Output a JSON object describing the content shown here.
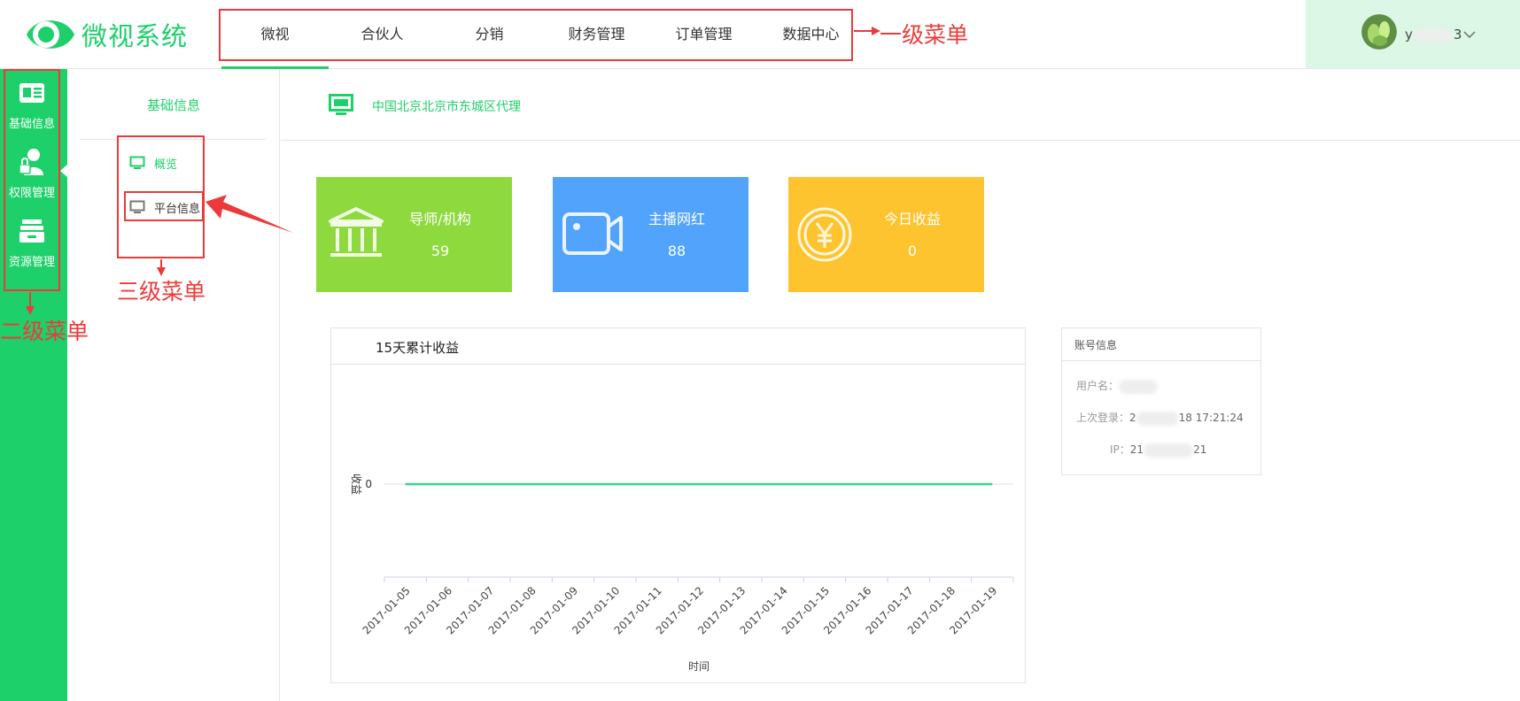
{
  "app": {
    "title": "微视系统"
  },
  "topnav": {
    "items": [
      {
        "label": "微视"
      },
      {
        "label": "合伙人"
      },
      {
        "label": "分销"
      },
      {
        "label": "财务管理"
      },
      {
        "label": "订单管理"
      },
      {
        "label": "数据中心"
      }
    ],
    "active_index": 0
  },
  "user": {
    "name": "y",
    "name_tail": "3"
  },
  "sidebar": {
    "items": [
      {
        "label": "基础信息",
        "icon": "id-card-icon",
        "active": true
      },
      {
        "label": "权限管理",
        "icon": "user-lock-icon"
      },
      {
        "label": "资源管理",
        "icon": "drawer-icon"
      }
    ]
  },
  "submenu": {
    "title": "基础信息",
    "items": [
      {
        "label": "概览",
        "icon": "monitor-icon",
        "active": true
      },
      {
        "label": "平台信息",
        "icon": "monitor-icon"
      }
    ]
  },
  "breadcrumb": {
    "text": "中国北京北京市东城区代理",
    "icon": "monitor-icon"
  },
  "cards": [
    {
      "title": "导师/机构",
      "value": "59",
      "color": "#8ed93e",
      "icon": "bank-icon"
    },
    {
      "title": "主播网红",
      "value": "88",
      "color": "#52a3fb",
      "icon": "video-camera-icon"
    },
    {
      "title": "今日收益",
      "value": "0",
      "color": "#fdc42f",
      "icon": "yen-coin-icon"
    }
  ],
  "chart_data": {
    "type": "line",
    "title": "15天累计收益",
    "xlabel": "时间",
    "ylabel": "收益",
    "categories": [
      "2017-01-05",
      "2017-01-06",
      "2017-01-07",
      "2017-01-08",
      "2017-01-09",
      "2017-01-10",
      "2017-01-11",
      "2017-01-12",
      "2017-01-13",
      "2017-01-14",
      "2017-01-15",
      "2017-01-16",
      "2017-01-17",
      "2017-01-18",
      "2017-01-19"
    ],
    "series": [
      {
        "values": [
          0,
          0,
          0,
          0,
          0,
          0,
          0,
          0,
          0,
          0,
          0,
          0,
          0,
          0,
          0
        ],
        "color": "#3cd38a"
      }
    ],
    "yticks": [
      "0"
    ],
    "grid": true,
    "legend": "none"
  },
  "account": {
    "title": "账号信息",
    "username_label": "用户名：",
    "last_login_label": "上次登录：",
    "last_login_head": "2",
    "last_login_tail": "18 17:21:24",
    "ip_label": "IP：",
    "ip_head": "21",
    "ip_tail": "21"
  },
  "annotations": {
    "level1": "一级菜单",
    "level2": "二级菜单",
    "level3": "三级菜单",
    "color": "#ec3a3a"
  },
  "colors": {
    "brand": "#1ed06a",
    "user_bg": "#dcf7e6"
  }
}
